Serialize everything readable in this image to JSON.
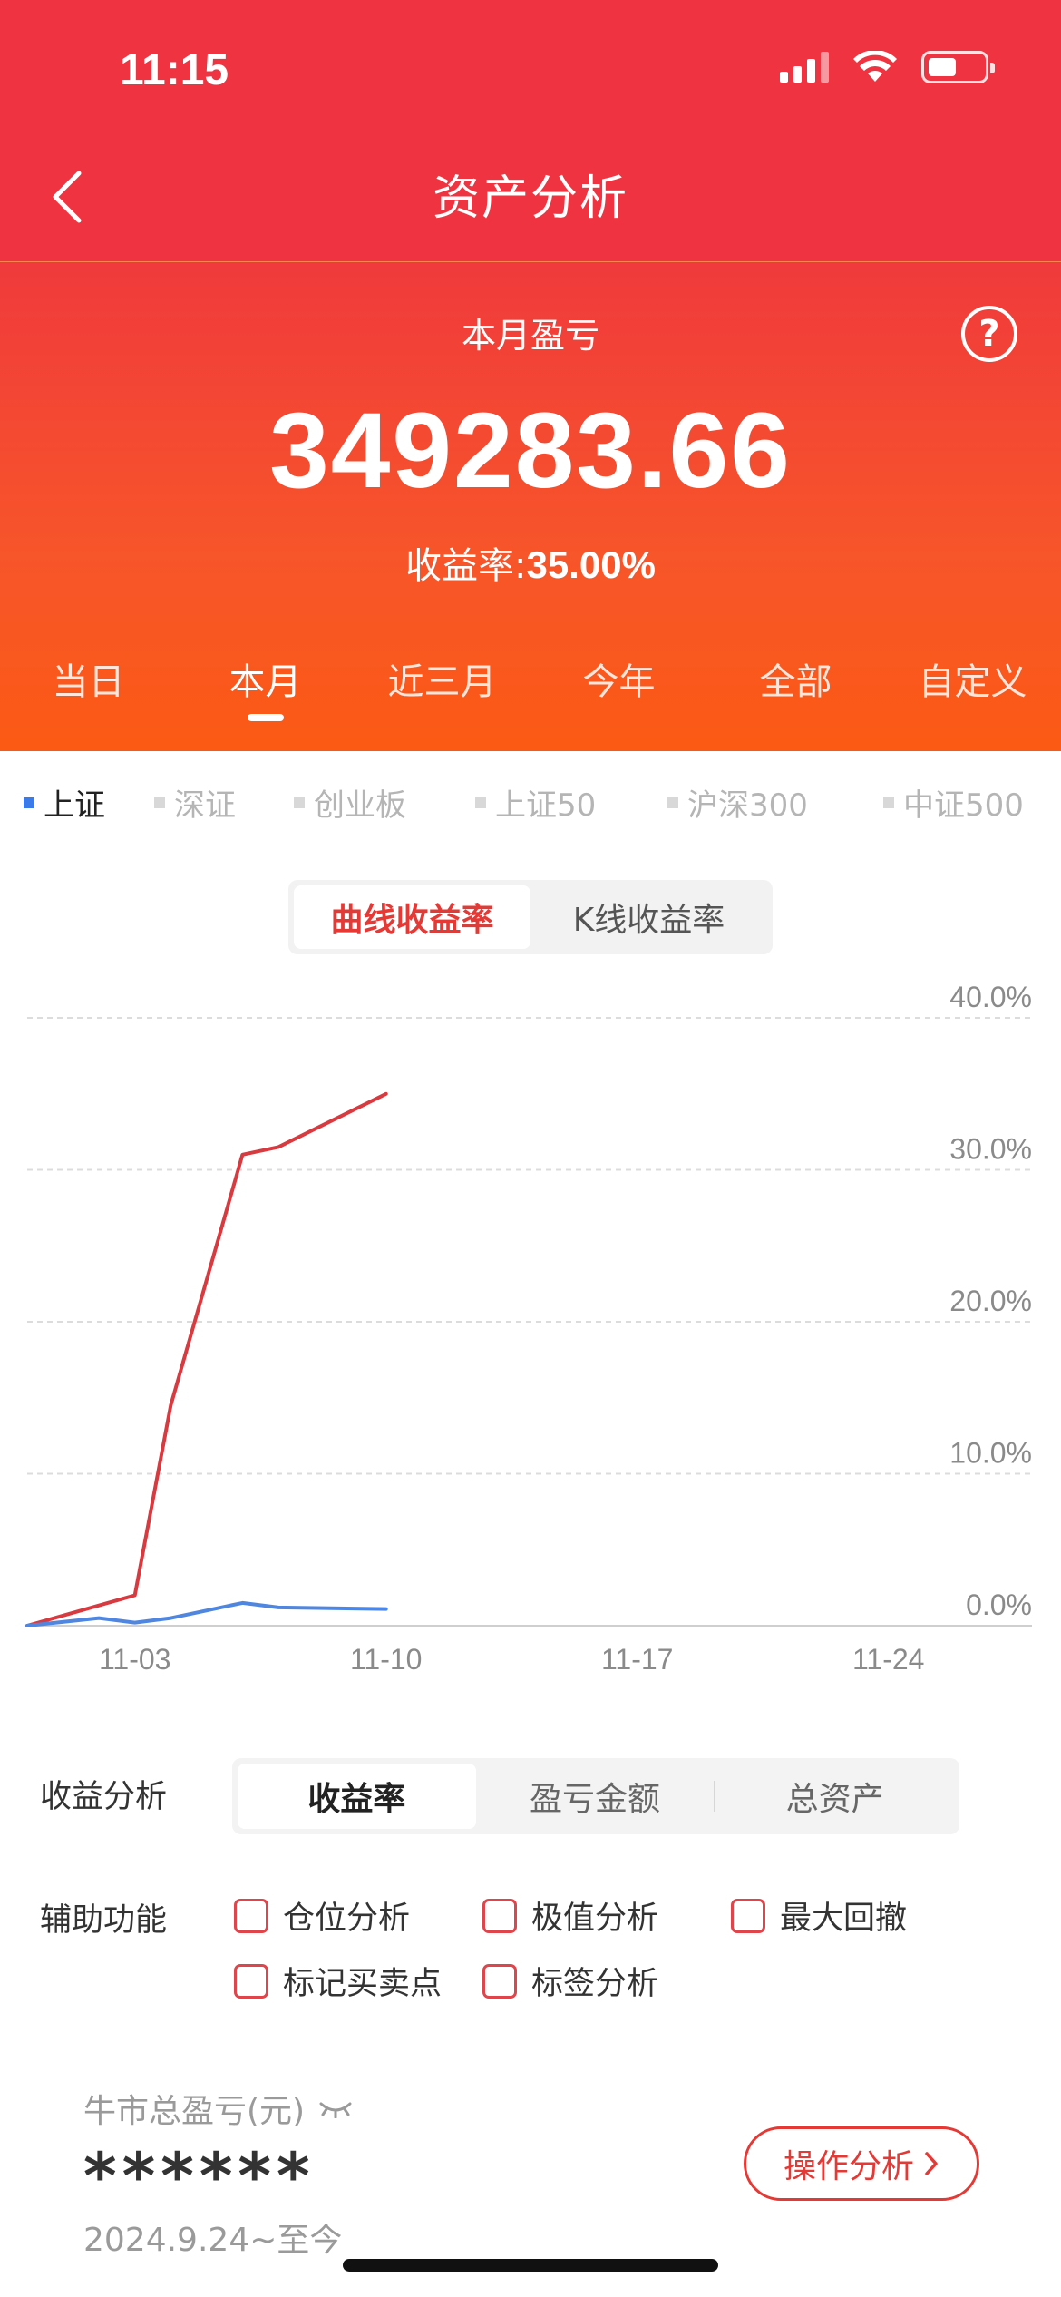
{
  "status_bar": {
    "time": "11:15"
  },
  "nav": {
    "title": "资产分析"
  },
  "summary": {
    "label": "本月盈亏",
    "amount": "349283.66",
    "rate_label": "收益率:",
    "rate_value": "35.00%",
    "help_glyph": "?"
  },
  "period_tabs": [
    {
      "label": "当日",
      "active": false
    },
    {
      "label": "本月",
      "active": true
    },
    {
      "label": "近三月",
      "active": false
    },
    {
      "label": "今年",
      "active": false
    },
    {
      "label": "全部",
      "active": false
    },
    {
      "label": "自定义",
      "active": false
    }
  ],
  "index_tabs": [
    {
      "label": "上证",
      "active": true
    },
    {
      "label": "深证",
      "active": false
    },
    {
      "label": "创业板",
      "active": false
    },
    {
      "label": "上证50",
      "active": false
    },
    {
      "label": "沪深300",
      "active": false
    },
    {
      "label": "中证500",
      "active": false
    }
  ],
  "chart_toggle": {
    "options": [
      "曲线收益率",
      "K线收益率"
    ],
    "active_index": 0
  },
  "chart_data": {
    "type": "line",
    "ylim": [
      0,
      40
    ],
    "y_ticks": [
      "40.0%",
      "30.0%",
      "20.0%",
      "10.0%",
      "0.0%"
    ],
    "y_tick_values": [
      40,
      30,
      20,
      10,
      0
    ],
    "x_ticks": [
      "11-03",
      "11-10",
      "11-17",
      "11-24"
    ],
    "x_tick_days": [
      3,
      10,
      17,
      24
    ],
    "x_range_days": [
      0,
      28
    ],
    "grid": true,
    "series": [
      {
        "color": "#d83a3f",
        "points": [
          [
            0,
            0.0
          ],
          [
            3,
            2.0
          ],
          [
            4,
            14.5
          ],
          [
            6,
            31.0
          ],
          [
            7,
            31.5
          ],
          [
            10,
            35.0
          ]
        ]
      },
      {
        "color": "#4f86e0",
        "points": [
          [
            0,
            0.0
          ],
          [
            2,
            0.5
          ],
          [
            3,
            0.2
          ],
          [
            4,
            0.5
          ],
          [
            6,
            1.5
          ],
          [
            7,
            1.2
          ],
          [
            10,
            1.1
          ]
        ]
      }
    ]
  },
  "analysis": {
    "label": "收益分析",
    "options": [
      "收益率",
      "盈亏金额",
      "总资产"
    ],
    "active_index": 0
  },
  "aux": {
    "label": "辅助功能",
    "items": [
      "仓位分析",
      "极值分析",
      "最大回撤",
      "标记买卖点",
      "标签分析"
    ]
  },
  "bull": {
    "label": "牛市总盈亏(元)",
    "masked_value": "******",
    "date_range": "2024.9.24~至今",
    "button_label": "操作分析"
  }
}
